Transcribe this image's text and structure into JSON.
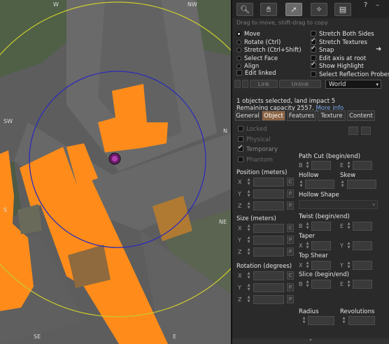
{
  "map": {
    "compass": {
      "nw_w": "W",
      "nw": "NW",
      "sw": "SW",
      "s": "S",
      "se": "SE",
      "e": "E",
      "n": "N",
      "ne": "NE"
    }
  },
  "toolbar": {
    "tools": [
      "focus-tool",
      "move-tool",
      "edit-tool",
      "create-tool",
      "land-tool"
    ],
    "help": "?",
    "minimize": "–"
  },
  "hint": "Drag to move, shift-drag to copy",
  "modes": [
    {
      "label": "Move",
      "on": true
    },
    {
      "label": "Rotate (Ctrl)",
      "on": false
    },
    {
      "label": "Stretch (Ctrl+Shift)",
      "on": false
    },
    {
      "label": "Select Face",
      "on": false
    },
    {
      "label": "Align",
      "on": false
    }
  ],
  "edit_linked": {
    "label": "Edit linked",
    "on": false
  },
  "options": [
    {
      "label": "Stretch Both Sides",
      "on": false
    },
    {
      "label": "Stretch Textures",
      "on": true
    },
    {
      "label": "Snap",
      "on": true
    },
    {
      "label": "Edit axis at root",
      "on": false
    },
    {
      "label": "Show Highlight",
      "on": true
    },
    {
      "label": "Select Reflection Probes",
      "on": false
    }
  ],
  "snap_arrow": "➜",
  "link_label": "Link",
  "unlink_label": "Unlink",
  "ref_frame": "World",
  "info": {
    "line1": "1 objects selected, land impact 5",
    "line2": "Remaining capacity 2557.",
    "more": "More info"
  },
  "tabs": [
    "General",
    "Object",
    "Features",
    "Texture",
    "Content"
  ],
  "active_tab": "Object",
  "checks": [
    {
      "label": "Locked",
      "on": false
    },
    {
      "label": "Physical",
      "on": false
    },
    {
      "label": "Temporary",
      "on": true
    },
    {
      "label": "Phantom",
      "on": false
    }
  ],
  "position_label": "Position (meters)",
  "size_label": "Size (meters)",
  "rotation_label": "Rotation (degrees)",
  "axes": [
    "X",
    "Y",
    "Z"
  ],
  "cpr": [
    "C",
    "P",
    "P"
  ],
  "path_cut": "Path Cut (begin/end)",
  "hollow": "Hollow",
  "skew": "Skew",
  "hollow_shape": "Hollow Shape",
  "twist": "Twist (begin/end)",
  "taper": "Taper",
  "top_shear": "Top Shear",
  "slice": "Slice (begin/end)",
  "radius": "Radius",
  "revolutions": "Revolutions",
  "be": [
    "B",
    "E"
  ],
  "xy": [
    "X",
    "Y"
  ],
  "bottom_arrow": "⌃"
}
